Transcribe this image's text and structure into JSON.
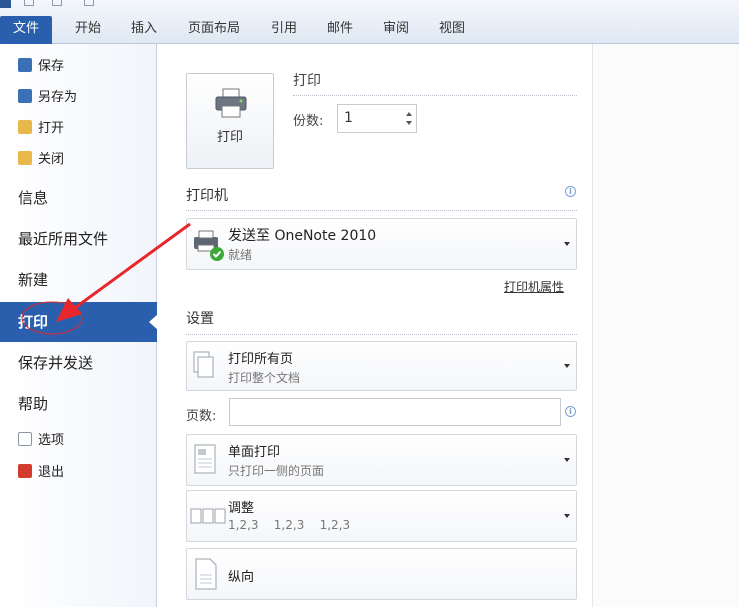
{
  "ribbon": {
    "tabs": [
      {
        "label": "文件"
      },
      {
        "label": "开始"
      },
      {
        "label": "插入"
      },
      {
        "label": "页面布局"
      },
      {
        "label": "引用"
      },
      {
        "label": "邮件"
      },
      {
        "label": "审阅"
      },
      {
        "label": "视图"
      }
    ]
  },
  "nav": {
    "small_items": [
      {
        "label": "保存",
        "icon": "save-icon"
      },
      {
        "label": "另存为",
        "icon": "save-as-icon"
      },
      {
        "label": "打开",
        "icon": "open-folder-icon"
      },
      {
        "label": "关闭",
        "icon": "close-folder-icon"
      }
    ],
    "large_items": [
      {
        "label": "信息"
      },
      {
        "label": "最近所用文件"
      },
      {
        "label": "新建"
      },
      {
        "label": "打印",
        "active": true
      },
      {
        "label": "保存并发送"
      },
      {
        "label": "帮助"
      }
    ],
    "bottom_items": [
      {
        "label": "选项",
        "icon": "options-icon"
      },
      {
        "label": "退出",
        "icon": "exit-icon"
      }
    ]
  },
  "print": {
    "button_label": "打印",
    "heading": "打印",
    "copies_label": "份数:",
    "copies_value": "1"
  },
  "printer": {
    "section_title": "打印机",
    "name": "发送至 OneNote 2010",
    "status": "就绪",
    "properties_link": "打印机属性"
  },
  "settings": {
    "section_title": "设置",
    "range": {
      "title": "打印所有页",
      "subtitle": "打印整个文档"
    },
    "pages_label": "页数:",
    "pages_value": "",
    "sides": {
      "title": "单面打印",
      "subtitle": "只打印一侧的页面"
    },
    "collate": {
      "title": "调整",
      "subtitle": "1,2,3    1,2,3    1,2,3"
    },
    "orientation": {
      "title": "纵向"
    }
  },
  "colors": {
    "accent": "#2a5fad",
    "annotation": "#e8262b"
  }
}
